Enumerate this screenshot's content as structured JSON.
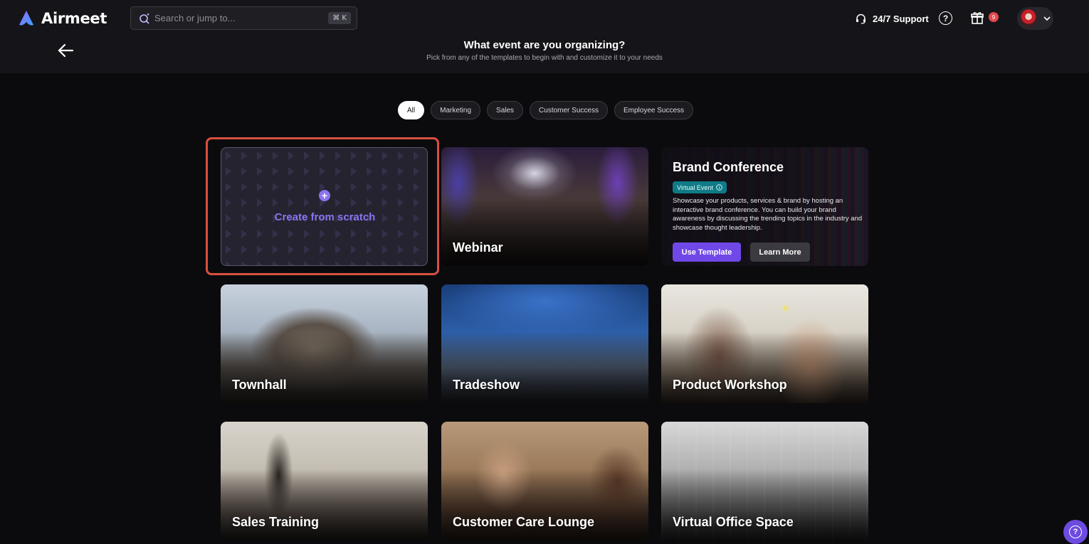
{
  "app": {
    "name": "Airmeet"
  },
  "search": {
    "placeholder": "Search or jump to...",
    "shortcut": "⌘ K"
  },
  "header": {
    "support_label": "24/7 Support",
    "help_icon": "?",
    "gift_badge_count": "9"
  },
  "page": {
    "title": "What event are you organizing?",
    "subtitle": "Pick from any of the templates to begin with and customize it to your needs"
  },
  "filters": [
    {
      "label": "All",
      "active": true
    },
    {
      "label": "Marketing",
      "active": false
    },
    {
      "label": "Sales",
      "active": false
    },
    {
      "label": "Customer Success",
      "active": false
    },
    {
      "label": "Employee Success",
      "active": false
    }
  ],
  "scratch": {
    "label": "Create from scratch",
    "plus": "+"
  },
  "brand": {
    "title": "Brand Conference",
    "badge": "Virtual Event",
    "description": "Showcase your products, services & brand by hosting an interactive brand conference. You can build your brand awareness by discussing the trending topics in the industry and showcase thought leadership.",
    "use_template": "Use Template",
    "learn_more": "Learn More"
  },
  "templates": [
    {
      "label": "Webinar"
    },
    {
      "label": "Townhall"
    },
    {
      "label": "Tradeshow"
    },
    {
      "label": "Product Workshop"
    },
    {
      "label": "Sales Training"
    },
    {
      "label": "Customer Care Lounge"
    },
    {
      "label": "Virtual Office Space"
    }
  ],
  "help_fab": {
    "label": "?"
  },
  "colors": {
    "accent": "#7048e8",
    "highlight": "#d9503f",
    "badge": "#0f7b86"
  }
}
